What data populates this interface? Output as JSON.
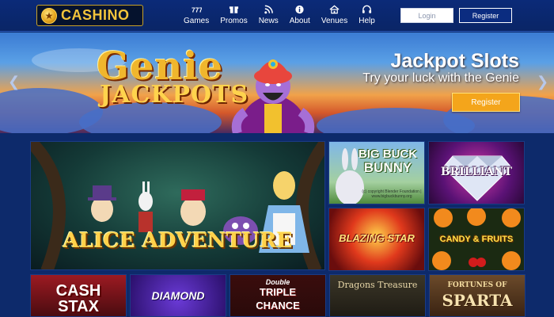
{
  "brand": {
    "name": "CASHINO",
    "logo_icon": "casino-chip-icon",
    "gold": "#f3c43b"
  },
  "nav": [
    {
      "label": "Games",
      "icon": "slot-777-icon"
    },
    {
      "label": "Promos",
      "icon": "gift-icon"
    },
    {
      "label": "News",
      "icon": "rss-icon"
    },
    {
      "label": "About",
      "icon": "info-icon"
    },
    {
      "label": "Venues",
      "icon": "home-icon"
    },
    {
      "label": "Help",
      "icon": "headset-icon"
    }
  ],
  "auth": {
    "login_label": "Login",
    "register_label": "Register"
  },
  "banner": {
    "logo_line1": "Genie",
    "logo_line2": "JACKPOTS",
    "title": "Jackpot Slots",
    "subtitle": "Try your luck with the Genie",
    "cta_label": "Register",
    "cta_color": "#f4a51b",
    "prev_icon": "chevron-left-icon",
    "next_icon": "chevron-right-icon"
  },
  "games": [
    {
      "title": "ALICE ADVENTURE"
    },
    {
      "title_line1": "BIG BUCK",
      "title_line2": "BUNNY",
      "credit": "(c) copyright Blender Foundation | www.bigbuckbunny.org"
    },
    {
      "title": "BRILLIANT"
    },
    {
      "title": "BLAZING STAR"
    },
    {
      "title": "CANDY & FRUITS"
    },
    {
      "title_line1": "CASH",
      "title_line2": "STAX"
    },
    {
      "title": "DIAMOND"
    },
    {
      "title_line1": "Double",
      "title_line2": "TRIPLE",
      "title_line3": "CHANCE"
    },
    {
      "title": "Dragons Treasure"
    },
    {
      "title_line1": "FORTUNES OF",
      "title_line2": "SPARTA"
    }
  ]
}
